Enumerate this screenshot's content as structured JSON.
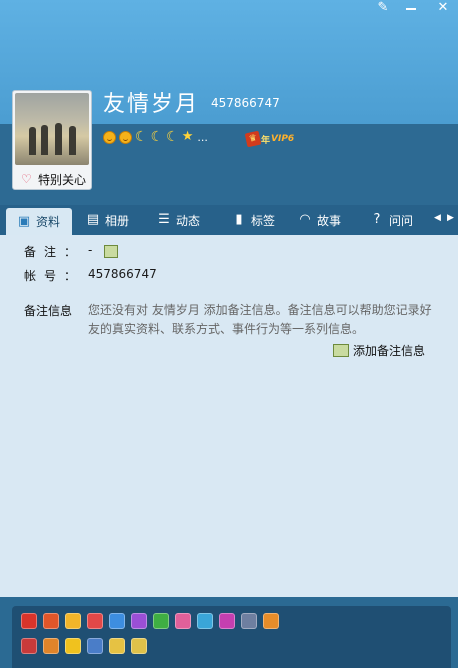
{
  "window": {
    "controls": [
      {
        "name": "skin",
        "glyph": "✎"
      },
      {
        "name": "minimize",
        "glyph": ""
      },
      {
        "name": "close",
        "glyph": "✕"
      }
    ]
  },
  "profile": {
    "nickname": "友情岁月",
    "qq_number": "457866747",
    "favorite_label": "特别关心",
    "level_more": "...",
    "vip_year": "年",
    "vip_text": "VIP6"
  },
  "tabs": [
    {
      "label": "资料",
      "icon": "profile-card-icon",
      "glyph": "▣",
      "active": true
    },
    {
      "label": "相册",
      "icon": "album-icon",
      "glyph": "▤",
      "active": false
    },
    {
      "label": "动态",
      "icon": "feed-list-icon",
      "glyph": "☰",
      "active": false
    },
    {
      "label": "标签",
      "icon": "tag-icon",
      "glyph": "▮",
      "active": false
    },
    {
      "label": "故事",
      "icon": "story-wave-icon",
      "glyph": "◠",
      "active": false
    },
    {
      "label": "问问",
      "icon": "qa-icon",
      "glyph": "?",
      "active": false
    }
  ],
  "tab_nav": {
    "prev": "◀",
    "next": "▶"
  },
  "details": {
    "remark_label": "备注：",
    "remark_value": "-",
    "account_label": "帐号：",
    "account_value": "457866747",
    "info_label": "备注信息",
    "info_text": "您还没有对 友情岁月 添加备注信息。备注信息可以帮助您记录好友的真实资料、联系方式、事件行为等一系列信息。",
    "add_remark_label": "添加备注信息"
  },
  "colors": {
    "header_top": "#5fb1e3",
    "header_band": "#2d6a93",
    "tab_bar": "#27618a",
    "content_bg": "#d9e8f3",
    "badge_panel": "#1f4f73"
  },
  "badges": {
    "row1": [
      {
        "icon": "red-diamond-badge-icon",
        "color": "#d9342b"
      },
      {
        "icon": "vip-year-badge-icon",
        "color": "#e0562a"
      },
      {
        "icon": "yellow-diamond-badge-icon",
        "color": "#f2b52a"
      },
      {
        "icon": "red-heart-diamond-badge-icon",
        "color": "#e24848"
      },
      {
        "icon": "blue-diamond-badge-icon",
        "color": "#3d8ee0"
      },
      {
        "icon": "purple-diamond-badge-icon",
        "color": "#9a4fd6"
      },
      {
        "icon": "green-diamond-badge-icon",
        "color": "#3fae43"
      },
      {
        "icon": "pink-diamond-badge-icon",
        "color": "#e0609a"
      },
      {
        "icon": "music-diamond-badge-icon",
        "color": "#3aa6d8"
      },
      {
        "icon": "magenta-diamond-badge-icon",
        "color": "#c43fb0"
      },
      {
        "icon": "game-badge-icon",
        "color": "#6e7fa0"
      },
      {
        "icon": "gift-badge-icon",
        "color": "#e68d2a"
      }
    ],
    "row2": [
      {
        "icon": "ava-badge-icon",
        "color": "#c83a3a"
      },
      {
        "icon": "pet-badge-icon",
        "color": "#e0842a"
      },
      {
        "icon": "yellow-face-badge-icon",
        "color": "#f0c21e"
      },
      {
        "icon": "blue-grid-badge-icon",
        "color": "#4a7dc8"
      },
      {
        "icon": "map-badge-icon",
        "color": "#e6c243"
      },
      {
        "icon": "cursor-badge-icon",
        "color": "#e0c24a"
      }
    ]
  }
}
